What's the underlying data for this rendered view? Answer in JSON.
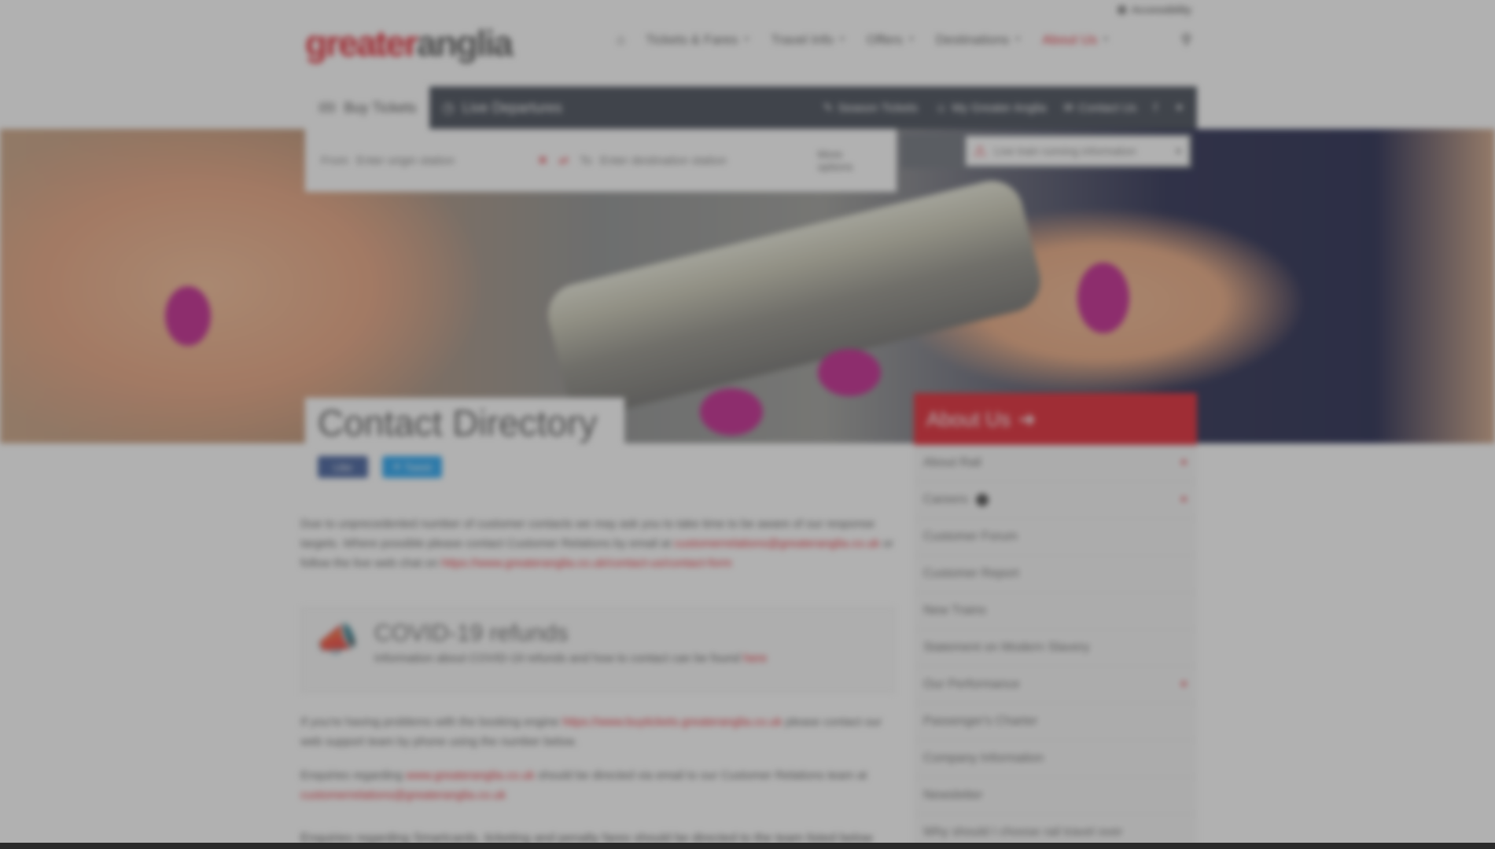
{
  "header": {
    "accessibility_label": "Accessibility",
    "logo_part1": "greater",
    "logo_part2": "anglia",
    "nav": [
      {
        "label": "Tickets & Fares"
      },
      {
        "label": "Travel Info"
      },
      {
        "label": "Offers"
      },
      {
        "label": "Destinations"
      },
      {
        "label": "About Us"
      }
    ]
  },
  "tabs": {
    "buy_tickets": "Buy Tickets",
    "live_departures": "Live Departures",
    "season_tickets": "Season Tickets",
    "my_greater_anglia": "My Greater Anglia",
    "contact_us": "Contact Us"
  },
  "journey": {
    "from_label": "From",
    "from_placeholder": "Enter origin station",
    "to_label": "To",
    "to_placeholder": "Enter destination station",
    "more_label": "More options",
    "status_placeholder": "Live train running information"
  },
  "page": {
    "title": "Contact Directory",
    "facebook_label": "Like",
    "twitter_label": "Tweet"
  },
  "content": {
    "p1_text": "Due to unprecedented number of customer contacts we may ask you to take time to be aware of our response targets. Where possible please contact Customer Relations by email at",
    "p1_email": "customerrelations@greateranglia.co.uk",
    "p1_text2": "or follow the live web chat on",
    "p1_link": "https://www.greateranglia.co.uk/contact-us/contact-form",
    "notice_title": "COVID-19 refunds",
    "notice_text": "Information about COVID-19 refunds and how to contact can be found",
    "notice_link": "here",
    "p2_text": "If you're having problems with the booking engine",
    "p2_link": "https://www.buytickets.greateranglia.co.uk",
    "p2_text2": "please contact our web support team by phone using the number below.",
    "p3_text": "Enquiries regarding",
    "p3_link": "www.greateranglia.co.uk",
    "p3_text2": "should be directed via email to our Customer Relations team at",
    "p3_email": "customerrelations@greateranglia.co.uk",
    "p4_text": "Enquiries regarding Smartcards, ticketing and penalty fares should be directed to the team listed below"
  },
  "sidebar": {
    "heading": "About Us",
    "items": [
      {
        "label": "About Rail",
        "plus": "+"
      },
      {
        "label": "Careers",
        "plus": "+"
      },
      {
        "label": "Customer Forum",
        "plus": ""
      },
      {
        "label": "Customer Report",
        "plus": ""
      },
      {
        "label": "New Trains",
        "plus": ""
      },
      {
        "label": "Statement on Modern Slavery",
        "plus": ""
      },
      {
        "label": "Our Performance",
        "plus": "+"
      },
      {
        "label": "Passenger's Charter",
        "plus": ""
      },
      {
        "label": "Company Information",
        "plus": ""
      },
      {
        "label": "Newsletter",
        "plus": ""
      },
      {
        "label": "Why should I choose rail travel over",
        "plus": ""
      }
    ]
  }
}
